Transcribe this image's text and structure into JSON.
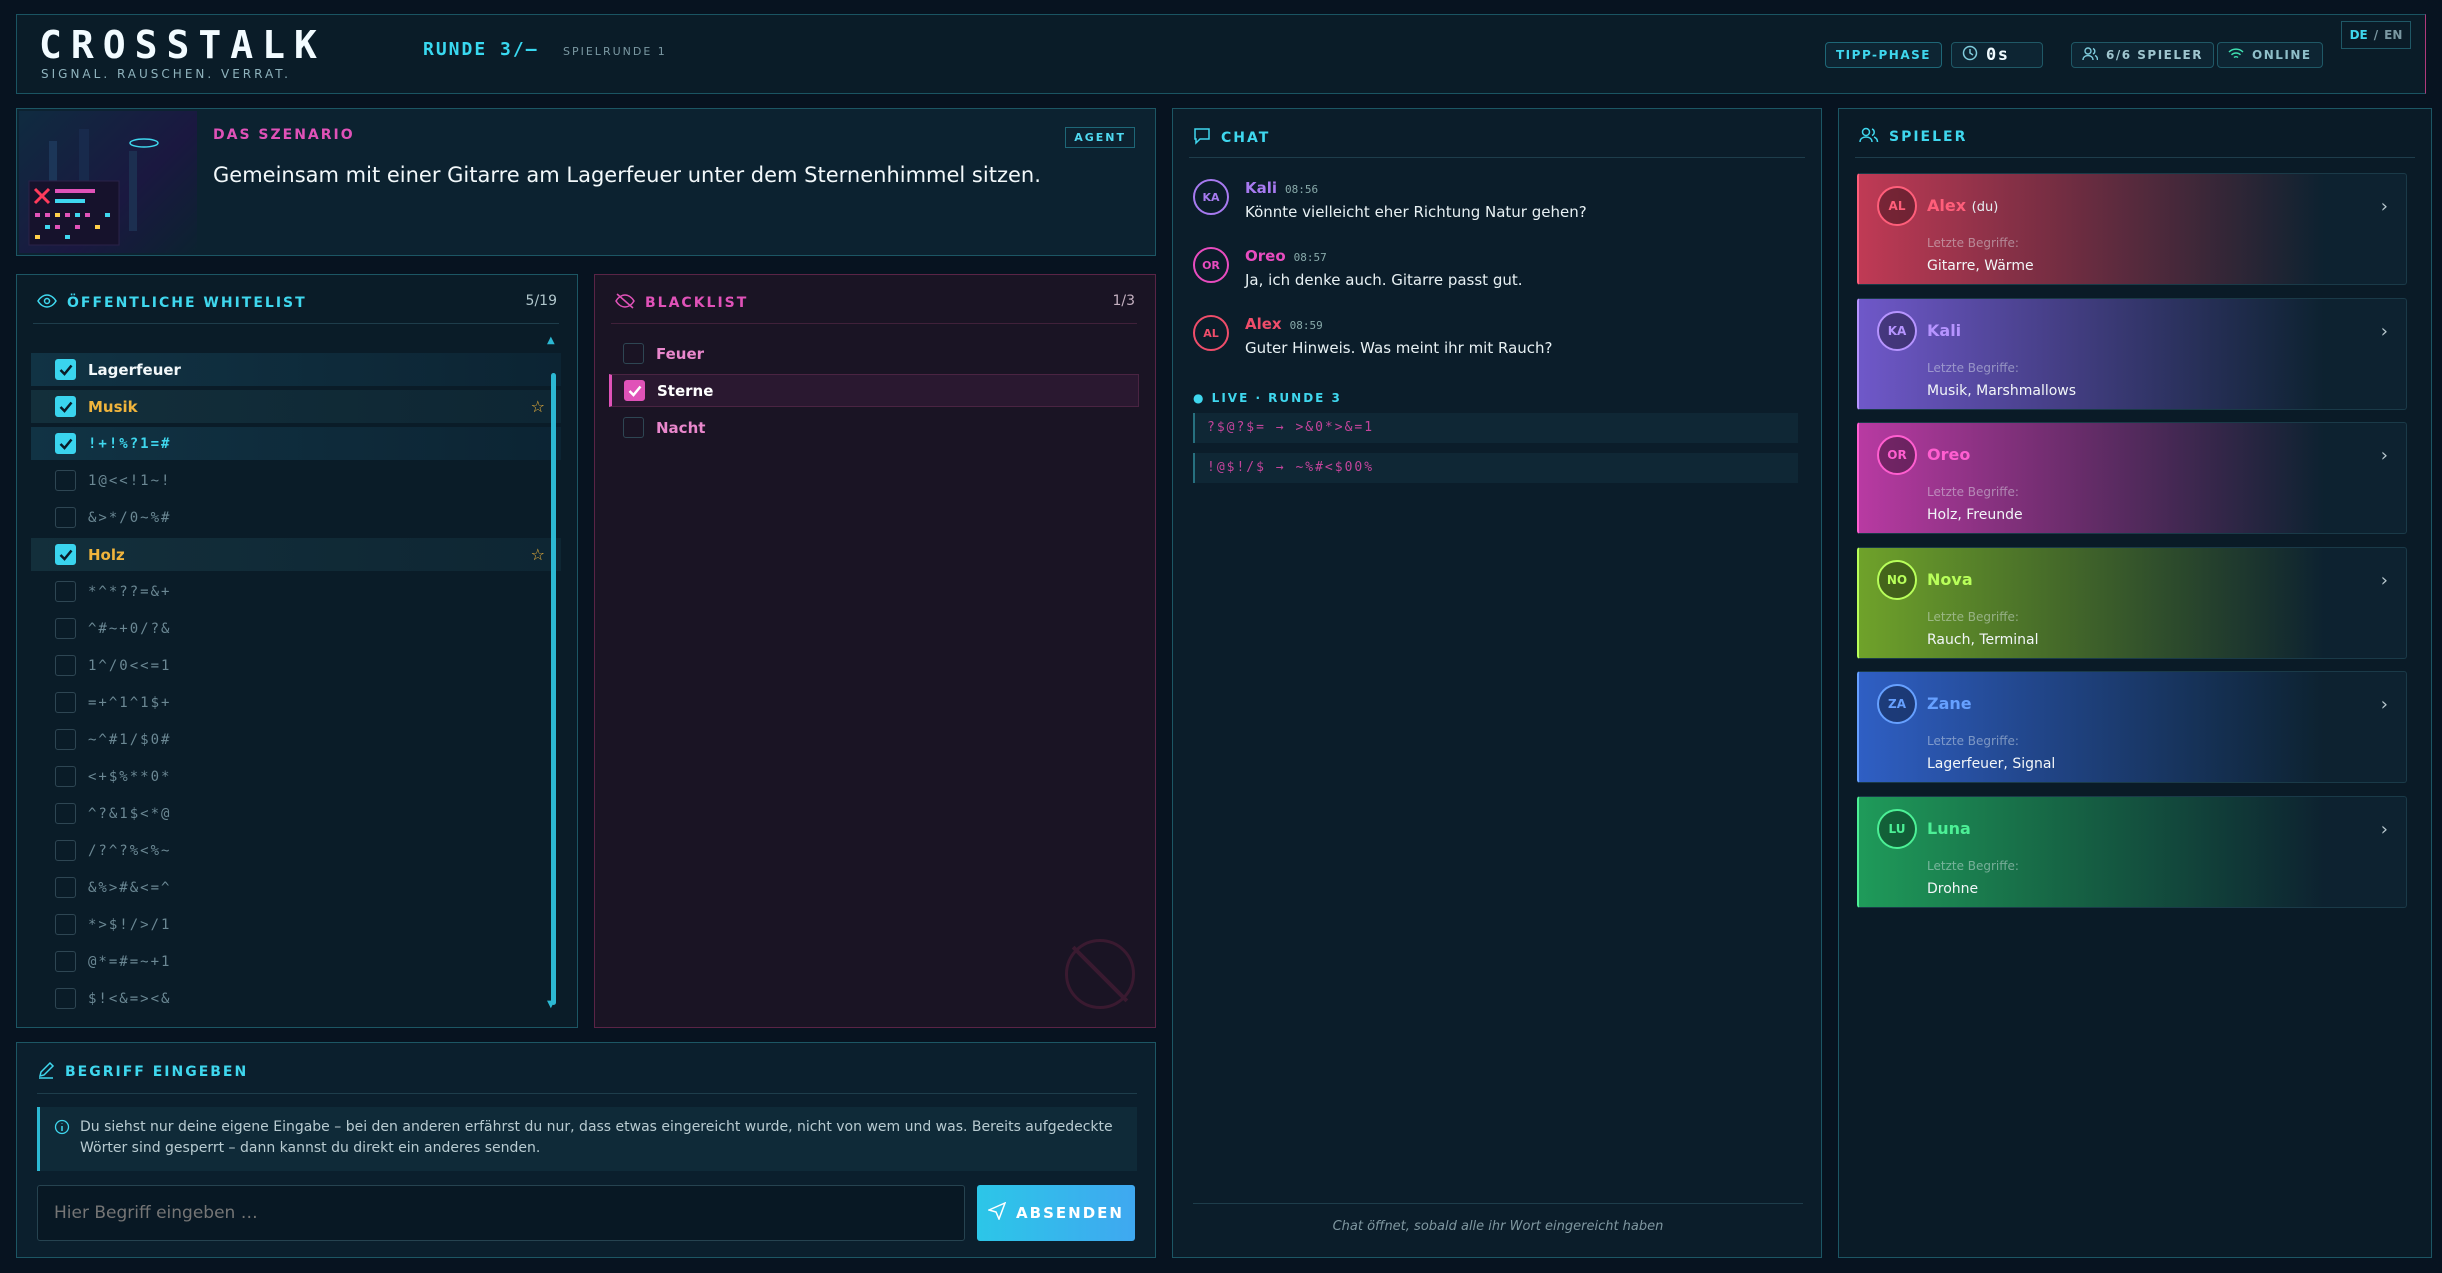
{
  "header": {
    "logo": "CROSSTALK",
    "tagline": "SIGNAL. RAUSCHEN. VERRAT.",
    "round": "RUNDE 3/–",
    "subround": "SPIELRUNDE 1",
    "phase": "TIPP-PHASE",
    "timer": "0s",
    "players": "6/6 SPIELER",
    "status": "ONLINE",
    "lang_de": "DE",
    "lang_sep": "/",
    "lang_en": "EN"
  },
  "scenario": {
    "title": "DAS SZENARIO",
    "badge": "AGENT",
    "text": "Gemeinsam mit einer Gitarre am Lagerfeuer unter dem Sternenhimmel sitzen."
  },
  "whitelist": {
    "title": "ÖFFENTLICHE WHITELIST",
    "count": "5/19",
    "items": [
      {
        "label": "Lagerfeuer",
        "checked": true,
        "star": false
      },
      {
        "label": "Musik",
        "checked": true,
        "star": true
      },
      {
        "label": "!+!%?1=#",
        "checked": true,
        "star": false
      },
      {
        "label": "1@<<!1~!",
        "checked": false,
        "star": false
      },
      {
        "label": "&>*/0~%#",
        "checked": false,
        "star": false
      },
      {
        "label": "Holz",
        "checked": true,
        "star": true
      },
      {
        "label": "*^*??=&+",
        "checked": false,
        "star": false
      },
      {
        "label": "^#~+0/?&",
        "checked": false,
        "star": false
      },
      {
        "label": "1^/0<<=1",
        "checked": false,
        "star": false
      },
      {
        "label": "=+^1^1$+",
        "checked": false,
        "star": false
      },
      {
        "label": "~^#1/$0#",
        "checked": false,
        "star": false
      },
      {
        "label": "<+$%**0*",
        "checked": false,
        "star": false
      },
      {
        "label": "^?&1$<*@",
        "checked": false,
        "star": false
      },
      {
        "label": "/?^?%<%~",
        "checked": false,
        "star": false
      },
      {
        "label": "&%>#&<=^",
        "checked": false,
        "star": false
      },
      {
        "label": "*>$!/>/1",
        "checked": false,
        "star": false
      },
      {
        "label": "@*=#=~+1",
        "checked": false,
        "star": false
      },
      {
        "label": "$!<&=><&",
        "checked": false,
        "star": false
      }
    ]
  },
  "blacklist": {
    "title": "BLACKLIST",
    "count": "1/3",
    "items": [
      {
        "label": "Feuer",
        "checked": false
      },
      {
        "label": "Sterne",
        "checked": true
      },
      {
        "label": "Nacht",
        "checked": false
      }
    ]
  },
  "input": {
    "title": "BEGRIFF EINGEBEN",
    "info": "Du siehst nur deine eigene Eingabe – bei den anderen erfährst du nur, dass etwas eingereicht wurde, nicht von wem und was. Bereits aufgedeckte Wörter sind gesperrt – dann kannst du direkt ein anderes senden.",
    "placeholder": "Hier Begriff eingeben …",
    "submit": "ABSENDEN"
  },
  "chat": {
    "title": "CHAT",
    "messages": [
      {
        "initials": "KA",
        "name": "Kali",
        "time": "08:56",
        "text": "Könnte vielleicht eher Richtung Natur gehen?",
        "color": "#a77af0"
      },
      {
        "initials": "OR",
        "name": "Oreo",
        "time": "08:57",
        "text": "Ja, ich denke auch. Gitarre passt gut.",
        "color": "#e84cbf"
      },
      {
        "initials": "AL",
        "name": "Alex",
        "time": "08:59",
        "text": "Guter Hinweis. Was meint ihr mit Rauch?",
        "color": "#ef4d6a"
      }
    ],
    "live_label": "LIVE · RUNDE 3",
    "live": [
      "?$@?$= → >&0*>&=1",
      "!@$!/$ → ~%#<$00%"
    ],
    "footer": "Chat öffnet, sobald alle ihr Wort eingereicht haben"
  },
  "players": {
    "title": "SPIELER",
    "last_label": "Letzte Begriffe:",
    "list": [
      {
        "initials": "AL",
        "name": "Alex",
        "you": "(du)",
        "terms": "Gitarre, Wärme",
        "color": "#ff5e7a",
        "bg": "#c03a55"
      },
      {
        "initials": "KA",
        "name": "Kali",
        "you": "",
        "terms": "Musik, Marshmallows",
        "color": "#b694ff",
        "bg": "#6f58c9"
      },
      {
        "initials": "OR",
        "name": "Oreo",
        "you": "",
        "terms": "Holz, Freunde",
        "color": "#ff5ed0",
        "bg": "#b83aa2"
      },
      {
        "initials": "NO",
        "name": "Nova",
        "you": "",
        "terms": "Rauch, Terminal",
        "color": "#b8ff5a",
        "bg": "#6fa22a"
      },
      {
        "initials": "ZA",
        "name": "Zane",
        "you": "",
        "terms": "Lagerfeuer, Signal",
        "color": "#66a0ff",
        "bg": "#2f5fc4"
      },
      {
        "initials": "LU",
        "name": "Luna",
        "you": "",
        "terms": "Drohne",
        "color": "#4cf096",
        "bg": "#1f9b5a"
      }
    ]
  }
}
